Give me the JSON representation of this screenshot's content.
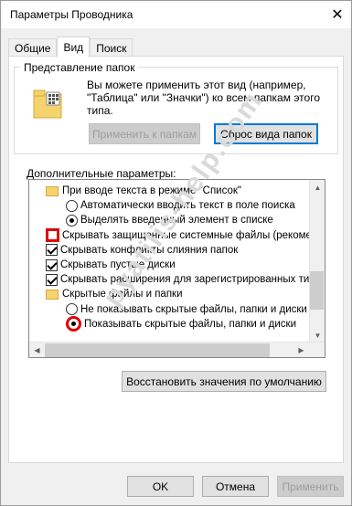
{
  "window": {
    "title": "Параметры Проводника",
    "close_icon": "close-icon"
  },
  "tabs": [
    {
      "label": "Общие",
      "active": false
    },
    {
      "label": "Вид",
      "active": true
    },
    {
      "label": "Поиск",
      "active": false
    }
  ],
  "folder_view": {
    "legend": "Представление папок",
    "description": "Вы можете применить этот вид (например, \"Таблица\" или \"Значки\") ко всем папкам этого типа.",
    "apply_button": "Применить к папкам",
    "reset_button": "Сброс вида папок"
  },
  "advanced": {
    "label": "Дополнительные параметры:",
    "items": [
      {
        "kind": "folder",
        "text": "При вводе текста в режиме \"Список\""
      },
      {
        "kind": "radio",
        "checked": false,
        "highlight": false,
        "text": "Автоматически вводить текст в поле поиска"
      },
      {
        "kind": "radio",
        "checked": true,
        "highlight": false,
        "text": "Выделять введенный элемент в списке"
      },
      {
        "kind": "checkbox",
        "checked": false,
        "highlight": true,
        "text": "Скрывать защищенные системные файлы (рекомен,"
      },
      {
        "kind": "checkbox",
        "checked": true,
        "highlight": false,
        "text": "Скрывать конфликты слияния папок"
      },
      {
        "kind": "checkbox",
        "checked": true,
        "highlight": false,
        "text": "Скрывать пустые диски"
      },
      {
        "kind": "checkbox",
        "checked": true,
        "highlight": false,
        "text": "Скрывать расширения для зарегистрированных типо"
      },
      {
        "kind": "folder",
        "text": "Скрытые файлы и папки"
      },
      {
        "kind": "radio",
        "checked": false,
        "highlight": false,
        "text": "Не показывать скрытые файлы, папки и диски"
      },
      {
        "kind": "radio",
        "checked": true,
        "highlight": true,
        "text": "Показывать скрытые файлы, папки и диски"
      }
    ]
  },
  "restore_button": "Восстановить значения по умолчанию",
  "footer": {
    "ok": "OK",
    "cancel": "Отмена",
    "apply": "Применить"
  },
  "watermark": "pyatilis-help.com",
  "colors": {
    "accent": "#0078d7",
    "highlight": "#e00000",
    "folder": "#f5d36e"
  }
}
